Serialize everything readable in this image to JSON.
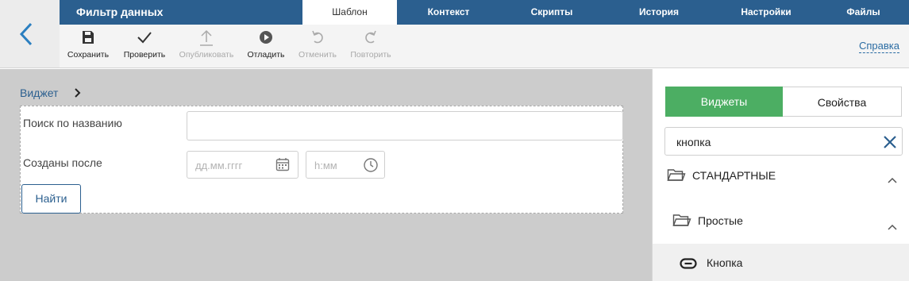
{
  "header": {
    "app_title": "Фильтр данных",
    "tabs": [
      {
        "label": "Шаблон",
        "active": true
      },
      {
        "label": "Контекст"
      },
      {
        "label": "Скрипты"
      },
      {
        "label": "История"
      },
      {
        "label": "Настройки"
      },
      {
        "label": "Файлы"
      }
    ]
  },
  "toolbar": {
    "buttons": [
      {
        "label": "Сохранить",
        "icon": "save-icon",
        "enabled": true
      },
      {
        "label": "Проверить",
        "icon": "check-icon",
        "enabled": true
      },
      {
        "label": "Опубликовать",
        "icon": "publish-icon",
        "enabled": false
      },
      {
        "label": "Отладить",
        "icon": "play-icon",
        "enabled": true
      },
      {
        "label": "Отменить",
        "icon": "undo-icon",
        "enabled": false
      },
      {
        "label": "Повторить",
        "icon": "redo-icon",
        "enabled": false
      }
    ],
    "help_link": "Справка"
  },
  "canvas": {
    "breadcrumb": "Виджет",
    "form": {
      "search_label": "Поиск по названию",
      "search_value": "",
      "created_label": "Созданы после",
      "date_placeholder": "дд.мм.гггг",
      "time_placeholder": "h:мм",
      "find_button": "Найти"
    }
  },
  "panel": {
    "tabs": [
      {
        "label": "Виджеты",
        "active": true
      },
      {
        "label": "Свойства"
      }
    ],
    "search_value": "кнопка",
    "groups": [
      {
        "label": "СТАНДАРТНЫЕ",
        "icon": "folder-icon",
        "expanded": true
      },
      {
        "label": "Простые",
        "icon": "folder-icon",
        "expanded": true
      }
    ],
    "items": [
      {
        "label": "Кнопка",
        "icon": "button-widget-icon"
      }
    ]
  },
  "colors": {
    "header_bg": "#2b5f8f",
    "accent_green": "#4cae63",
    "canvas_bg": "#cccccc",
    "link": "#2b6ca3"
  }
}
